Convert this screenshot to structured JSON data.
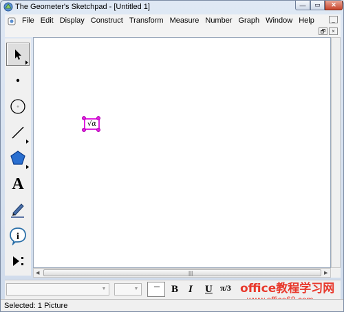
{
  "window": {
    "title": "The Geometer's Sketchpad - [Untitled 1]",
    "controls": {
      "minimize": "—",
      "maximize": "▭",
      "close": "✕"
    }
  },
  "menubar": {
    "items": [
      "File",
      "Edit",
      "Display",
      "Construct",
      "Transform",
      "Measure",
      "Number",
      "Graph",
      "Window",
      "Help"
    ],
    "mdi_controls": {
      "minimize": "_",
      "restore": "🗗",
      "close": "×"
    }
  },
  "toolbox": {
    "tools": [
      {
        "name": "selection-arrow-tool",
        "icon": "arrow-icon",
        "selected": true
      },
      {
        "name": "point-tool",
        "icon": "point-icon"
      },
      {
        "name": "compass-tool",
        "icon": "circle-icon"
      },
      {
        "name": "straightedge-tool",
        "icon": "segment-icon"
      },
      {
        "name": "polygon-tool",
        "icon": "pentagon-icon"
      },
      {
        "name": "text-tool",
        "icon": "letter-a-icon",
        "glyph": "A"
      },
      {
        "name": "marker-tool",
        "icon": "pen-icon"
      },
      {
        "name": "information-tool",
        "icon": "info-icon",
        "glyph": "i"
      },
      {
        "name": "custom-tool",
        "icon": "play-more-icon"
      }
    ]
  },
  "canvas": {
    "picture": {
      "label": "√α",
      "selected": true,
      "selection_color": "#e020e0"
    }
  },
  "formatbar": {
    "font_name": "",
    "font_size": "",
    "bold": "B",
    "italic": "I",
    "underline": "U",
    "math_symbol": "π/3"
  },
  "watermark": {
    "site": "office教程学习网",
    "url": "www.office68.com",
    "color": "#e8392c"
  },
  "status": {
    "text": "Selected: 1 Picture"
  }
}
